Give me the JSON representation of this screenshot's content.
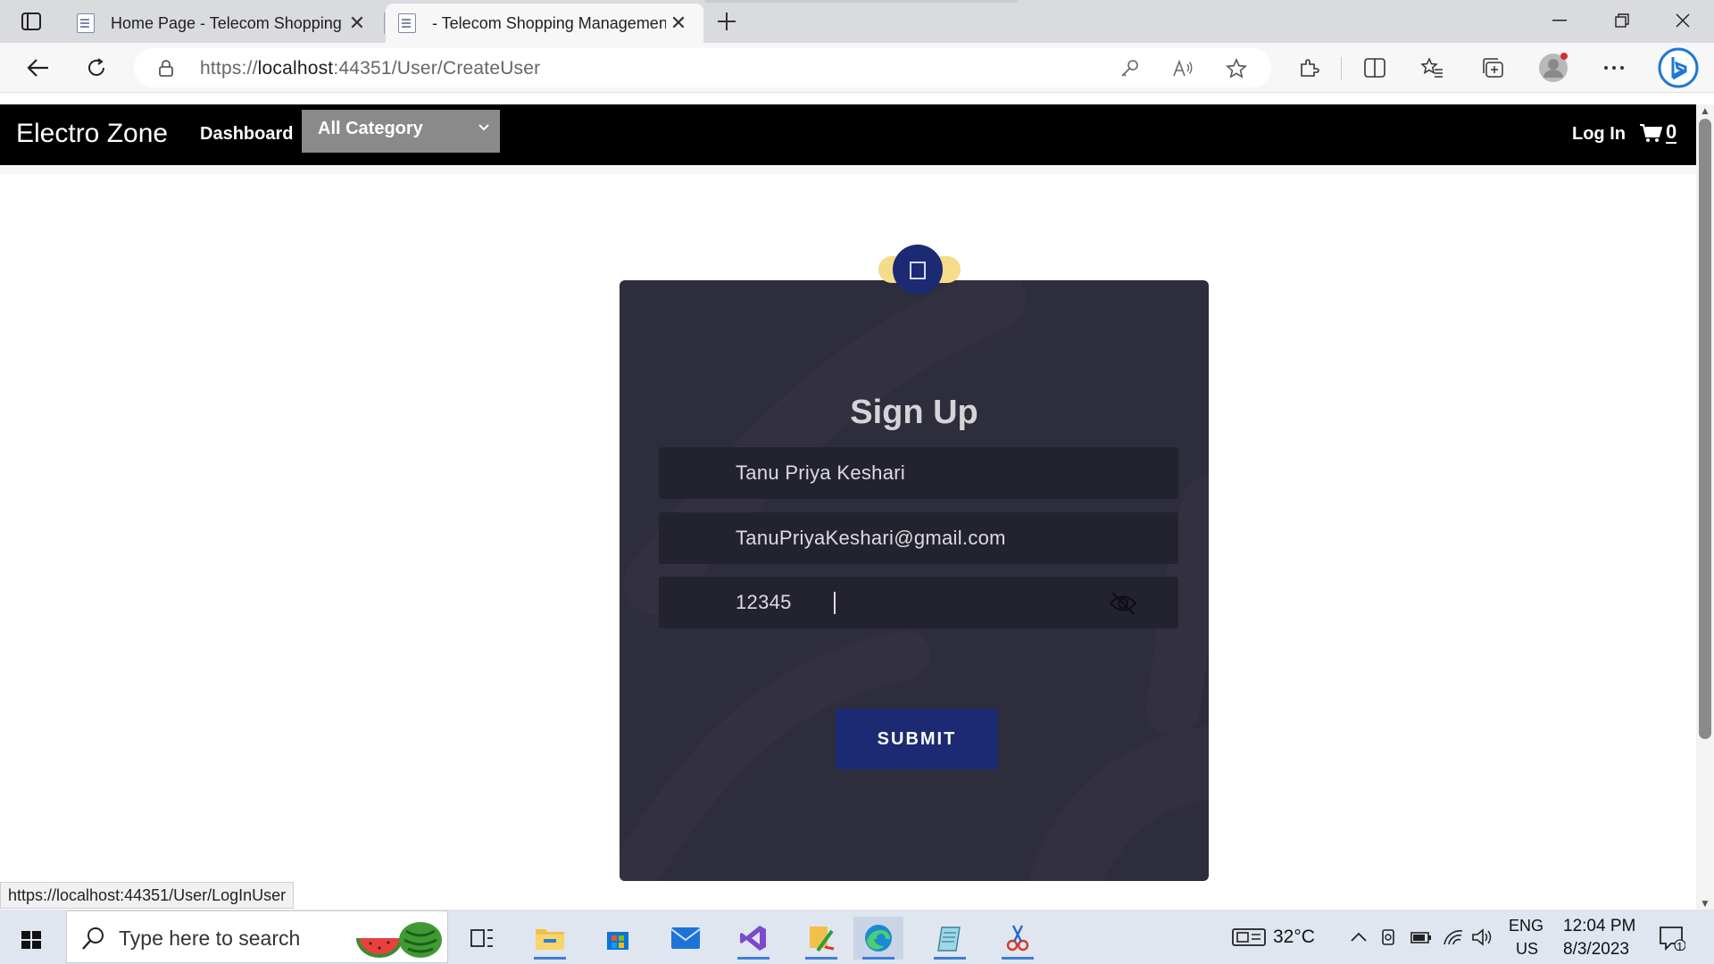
{
  "browser": {
    "tabs": [
      {
        "title": "Home Page - Telecom Shopping",
        "active": false
      },
      {
        "title": "- Telecom Shopping Managemen",
        "active": true
      }
    ],
    "url_prefix": "https://",
    "url_host": "localhost",
    "url_rest": ":44351/User/CreateUser",
    "status_url": "https://localhost:44351/User/LogInUser"
  },
  "navbar": {
    "brand": "Electro Zone",
    "dashboard": "Dashboard",
    "category_select": "All Category",
    "login": "Log In",
    "cart_count": "0"
  },
  "signup": {
    "title": "Sign Up",
    "name_value": "Tanu Priya Keshari",
    "email_value": "TanuPriyaKeshari@gmail.com",
    "password_value": "12345",
    "submit_label": "SUBMIT"
  },
  "taskbar": {
    "search_placeholder": "Type here to search",
    "weather": "32°C",
    "lang_top": "ENG",
    "lang_bottom": "US",
    "time": "12:04 PM",
    "date": "8/3/2023",
    "notification_count": "1"
  },
  "colors": {
    "navbar_bg": "#000000",
    "card_bg": "#2d2d3b",
    "field_bg": "#232330",
    "accent_navy": "#1c2a73",
    "badge_glow": "#f4dc8b"
  }
}
